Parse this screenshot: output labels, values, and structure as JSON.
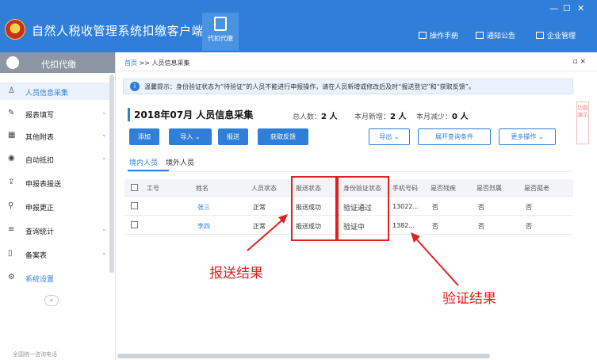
{
  "window": {
    "app_title": "自然人税收管理系统扣缴客户端",
    "module_tab": "代扣代缴",
    "controls": [
      "—",
      "☐",
      "✕"
    ],
    "top_links": [
      "操作手册",
      "通知公告",
      "企业管理"
    ]
  },
  "sidebar": {
    "header": "代扣代缴",
    "items": [
      {
        "label": "人员信息采集",
        "icon": "user-icon",
        "glyph": "♙"
      },
      {
        "label": "报表填写",
        "icon": "edit-icon",
        "glyph": "✎",
        "arrow": "⌄"
      },
      {
        "label": "其他附表",
        "icon": "grid-icon",
        "glyph": "▦",
        "arrow": "⌄"
      },
      {
        "label": "自动抵扣",
        "icon": "target-icon",
        "glyph": "◉",
        "arrow": "⌄"
      },
      {
        "label": "申报表报送",
        "icon": "submit-icon",
        "glyph": "⇪"
      },
      {
        "label": "申报更正",
        "icon": "search-icon",
        "glyph": "⚲"
      },
      {
        "label": "查询统计",
        "icon": "query-icon",
        "glyph": "≡",
        "arrow": "⌄"
      },
      {
        "label": "备案表",
        "icon": "document-icon",
        "glyph": "▯",
        "arrow": "⌄"
      },
      {
        "label": "系统设置",
        "icon": "gear-icon",
        "glyph": "⚙"
      }
    ],
    "collapse_glyph": "«",
    "footer": "全国统一咨询电话"
  },
  "breadcrumb": {
    "home": "首页",
    "sep": ">>",
    "current": "人员信息采集",
    "close": "▫ ×"
  },
  "tip": {
    "text": "温馨提示：身份验证状态为“待验证”的人员不能进行申报操作，请在人员新增或修改后及时“报送登记”和“获取反馈”。"
  },
  "side_tab": "功能演示",
  "summary": {
    "period_title": "2018年07月 人员信息采集",
    "total_label": "总人数：",
    "total_value": "2 人",
    "new_label": "本月新增：",
    "new_value": "2 人",
    "decrease_label": "本月减少：",
    "decrease_value": "0 人"
  },
  "toolbar": {
    "add": "添加",
    "import": "导入 ⌄",
    "submit": "报送",
    "feedback": "获取反馈",
    "export": "导出 ⌄",
    "expand_query": "展开查询条件",
    "more": "更多操作 ⌄"
  },
  "tabs": [
    "境内人员",
    "境外人员"
  ],
  "table": {
    "headers": [
      "工号",
      "姓名",
      "人员状态",
      "报送状态",
      "身份验证状态",
      "手机号码",
      "是否残疾",
      "是否烈属",
      "是否孤老"
    ],
    "rows": [
      [
        "",
        "张三",
        "正常",
        "报送成功",
        "验证通过",
        "13022...",
        "否",
        "否",
        "否"
      ],
      [
        "",
        "李四",
        "正常",
        "报送成功",
        "验证中",
        "1382...",
        "否",
        "否",
        "否"
      ]
    ]
  },
  "annotations": {
    "submit_result": "报送结果",
    "verify_result": "验证结果",
    "color": "#e02020"
  }
}
